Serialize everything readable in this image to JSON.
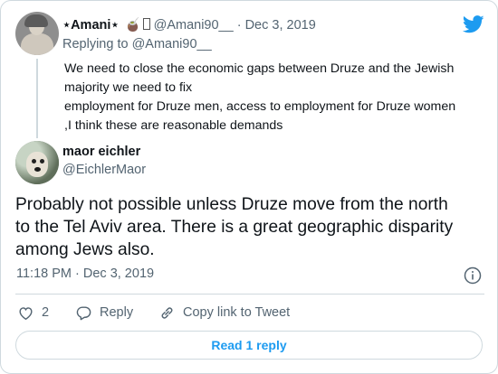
{
  "parent_tweet": {
    "display_name": "⋆Amani⋆",
    "emoji": "🧉",
    "handle": "@Amani90__",
    "separator": "·",
    "date": "Dec 3, 2019",
    "replying_to_label": "Replying to",
    "replying_to_handle": "@Amani90__",
    "text_lines": [
      "We need to close the economic gaps between Druze and the Jewish",
      "majority we need to fix",
      "employment for Druze men, access to employment for Druze women",
      ",I think these are reasonable demands"
    ]
  },
  "main_tweet": {
    "display_name": "maor eichler",
    "handle": "@EichlerMaor",
    "text_lines": [
      "Probably not possible unless Druze move from the north",
      "to the Tel Aviv area. There is a great geographic disparity",
      "among Jews also."
    ],
    "timestamp": "11:18 PM · Dec 3, 2019"
  },
  "actions": {
    "like_count": "2",
    "reply_label": "Reply",
    "copy_link_label": "Copy link to Tweet"
  },
  "read_replies_label": "Read 1 reply",
  "colors": {
    "accent": "#1d9bf0",
    "secondary_text": "#536471",
    "border": "#cfd9de"
  },
  "icons": [
    "twitter-bird-icon",
    "info-icon",
    "heart-icon",
    "reply-bubble-icon",
    "link-icon"
  ]
}
